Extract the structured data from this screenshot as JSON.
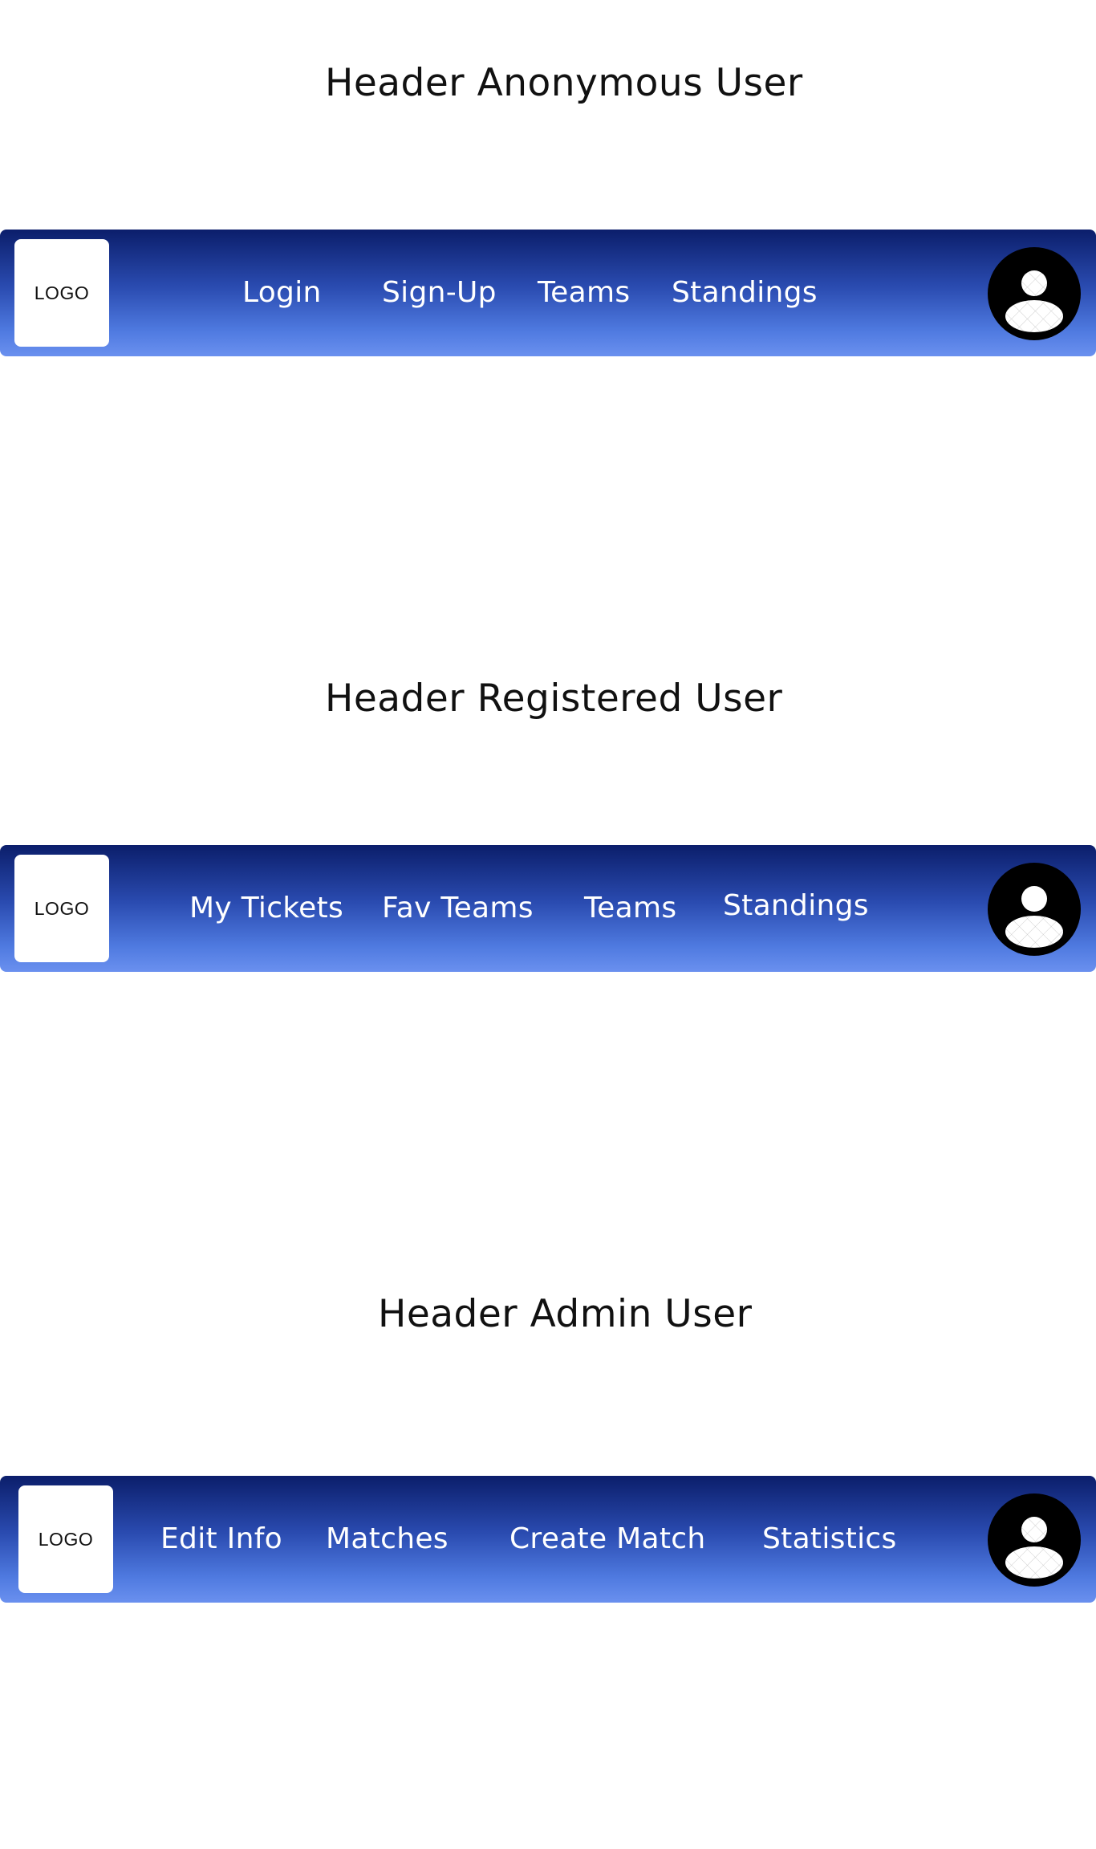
{
  "sections": [
    {
      "title": "Header Anonymous User",
      "logo": "LOGO",
      "nav": [
        "Login",
        "Sign-Up",
        "Teams",
        "Standings"
      ],
      "avatar_icon": "user-avatar-icon"
    },
    {
      "title": "Header Registered User",
      "logo": "LOGO",
      "nav": [
        "My Tickets",
        "Fav Teams",
        "Teams",
        "Standings"
      ],
      "avatar_icon": "user-avatar-icon"
    },
    {
      "title": "Header Admin User",
      "logo": "LOGO",
      "nav": [
        "Edit Info",
        "Matches",
        "Create Match",
        "Statistics"
      ],
      "avatar_icon": "user-avatar-icon"
    }
  ],
  "colors": {
    "navbar_top": "#0b1e6b",
    "navbar_bottom": "#6a90ef",
    "nav_text": "#ffffff",
    "logo_bg": "#ffffff",
    "avatar_bg": "#000000"
  }
}
